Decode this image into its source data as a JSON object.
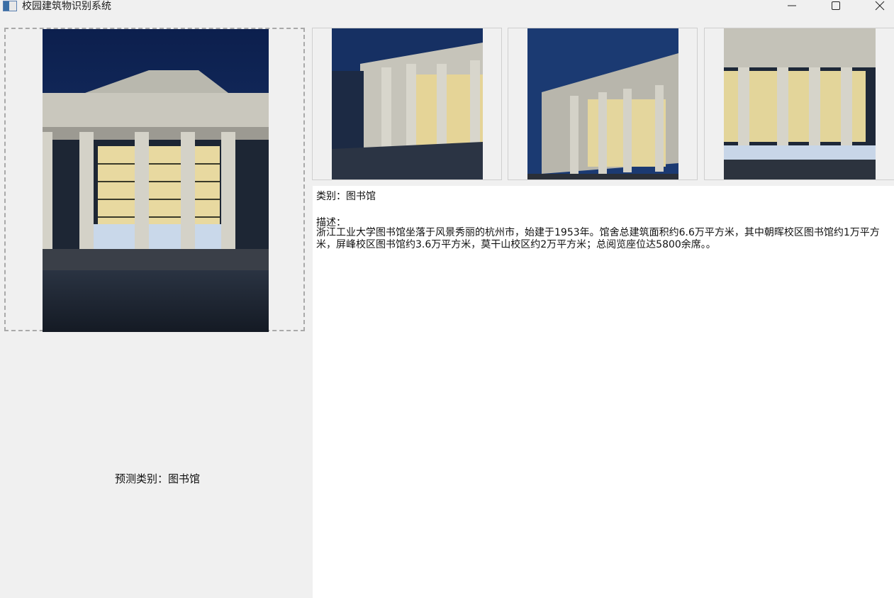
{
  "window": {
    "title": "校园建筑物识别系统",
    "minimize_icon": "minimize-icon",
    "maximize_icon": "maximize-icon",
    "close_icon": "close-icon"
  },
  "prediction": {
    "label": "预测类别：图书馆"
  },
  "info": {
    "category": "类别：图书馆",
    "description_heading": "描述：",
    "description": "浙江工业大学图书馆坐落于风景秀丽的杭州市，始建于1953年。馆舍总建筑面积约6.6万平方米，其中朝晖校区图书馆约1万平方米，屏峰校区图书馆约3.6万平方米，莫干山校区约2万平方米；总阅览座位达5800余席。。"
  }
}
